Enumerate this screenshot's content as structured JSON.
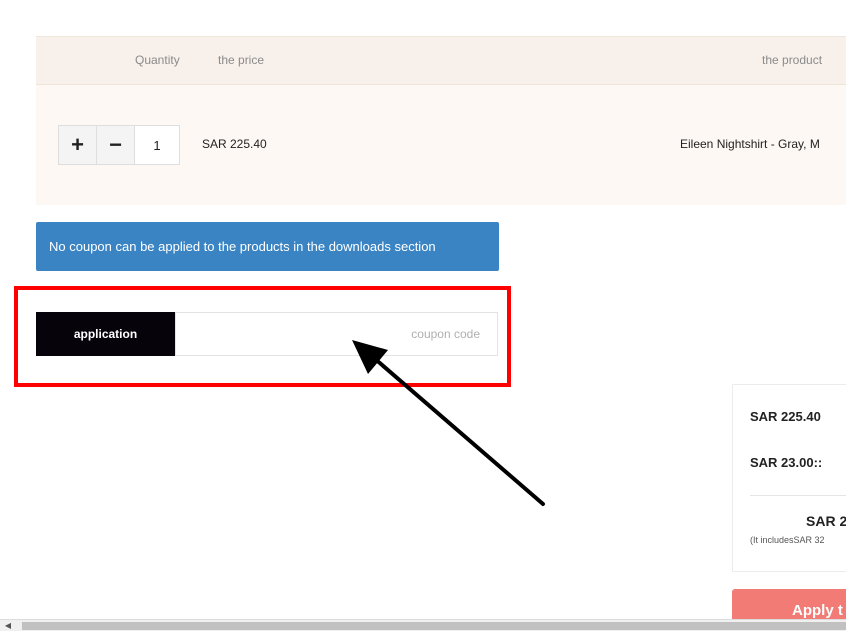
{
  "cart": {
    "headers": {
      "quantity": "Quantity",
      "price": "the price",
      "product": "the product"
    },
    "items": [
      {
        "quantity": "1",
        "price": "SAR 225.40",
        "product": "Eileen Nightshirt - Gray, M"
      }
    ],
    "plus_symbol": "+",
    "minus_symbol": "−"
  },
  "notice": {
    "text": "No coupon can be applied to the products in the downloads section"
  },
  "coupon": {
    "apply_label": "application",
    "placeholder": "coupon code"
  },
  "summary": {
    "subtotal": "SAR 225.40",
    "shipping": "SAR 23.00::",
    "total": "SAR 2",
    "vat_note": "(It includesSAR 32"
  },
  "checkout": {
    "label": "Apply t"
  },
  "colors": {
    "notice_bg": "#3a84c4",
    "highlight": "#ff0000",
    "checkout_bg": "#f27b75",
    "apply_bg": "#07030b"
  },
  "icons": {
    "plus": "plus-icon",
    "minus": "minus-icon",
    "arrow": "annotation-arrow-icon",
    "scroll_left": "scroll-left-arrow-icon"
  }
}
